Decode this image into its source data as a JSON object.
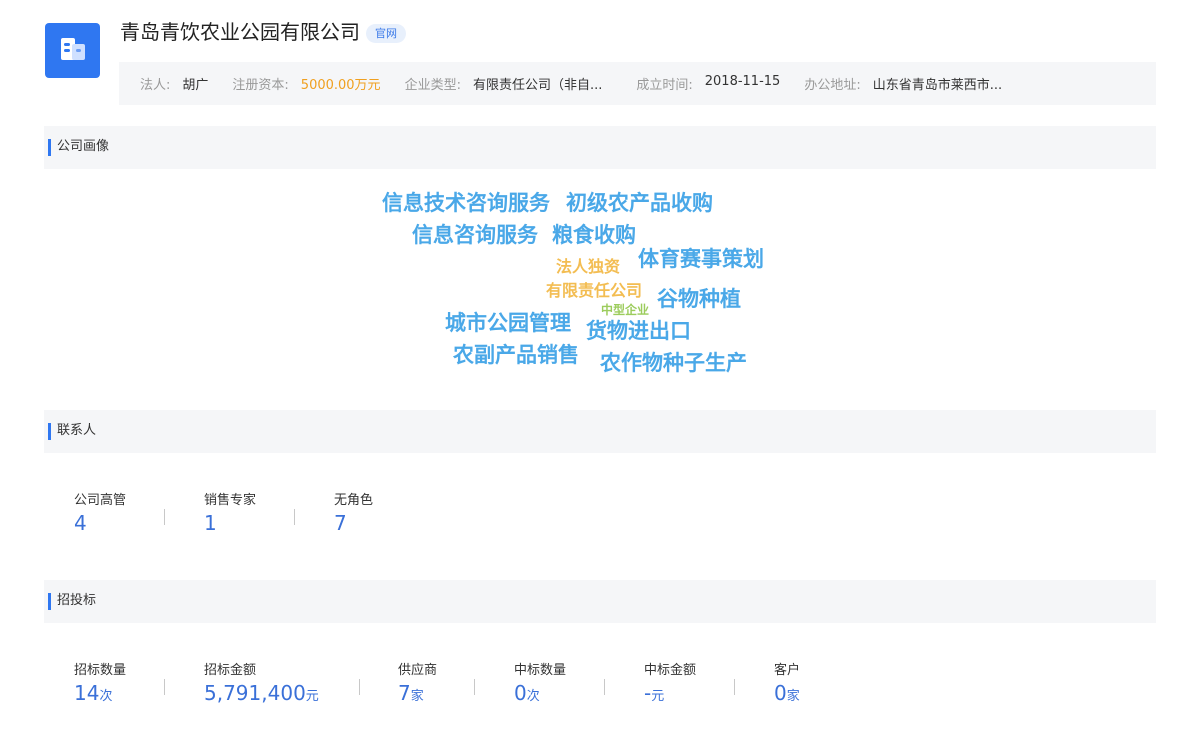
{
  "company": {
    "name": "青岛青饮农业公园有限公司",
    "badge": "官网",
    "logo_icon": "building-icon",
    "info": [
      {
        "label": "法人:",
        "value": "胡广"
      },
      {
        "label": "注册资本:",
        "value": "5000.00万元",
        "color": "#f0a020"
      },
      {
        "label": "企业类型:",
        "value": "有限责任公司（非自..."
      },
      {
        "label": "成立时间:",
        "value": "2018-11-15"
      },
      {
        "label": "办公地址:",
        "value": "山东省青岛市莱西市..."
      }
    ]
  },
  "profile": {
    "title": "公司画像",
    "words": [
      {
        "text": "信息技术咨询服务",
        "color": "#4aa8e8"
      },
      {
        "text": "初级农产品收购",
        "color": "#4aa8e8"
      },
      {
        "text": "信息咨询服务",
        "color": "#4aa8e8"
      },
      {
        "text": "粮食收购",
        "color": "#4aa8e8"
      },
      {
        "text": "法人独资",
        "color": "#f3bd52"
      },
      {
        "text": "体育赛事策划",
        "color": "#4aa8e8"
      },
      {
        "text": "有限责任公司",
        "color": "#f3bd52"
      },
      {
        "text": "中型企业",
        "color": "#9ccc5c"
      },
      {
        "text": "谷物种植",
        "color": "#4aa8e8"
      },
      {
        "text": "城市公园管理",
        "color": "#4aa8e8"
      },
      {
        "text": "货物进出口",
        "color": "#4aa8e8"
      },
      {
        "text": "农副产品销售",
        "color": "#4aa8e8"
      },
      {
        "text": "农作物种子生产",
        "color": "#4aa8e8"
      }
    ]
  },
  "contacts": {
    "title": "联系人",
    "stats": [
      {
        "label": "公司高管",
        "value": "4",
        "unit": ""
      },
      {
        "label": "销售专家",
        "value": "1",
        "unit": ""
      },
      {
        "label": "无角色",
        "value": "7",
        "unit": ""
      }
    ]
  },
  "bidding": {
    "title": "招投标",
    "stats": [
      {
        "label": "招标数量",
        "value": "14",
        "unit": "次"
      },
      {
        "label": "招标金额",
        "value": "5,791,400",
        "unit": "元"
      },
      {
        "label": "供应商",
        "value": "7",
        "unit": "家"
      },
      {
        "label": "中标数量",
        "value": "0",
        "unit": "次"
      },
      {
        "label": "中标金额",
        "value": "-",
        "unit": "元"
      },
      {
        "label": "客户",
        "value": "0",
        "unit": "家"
      }
    ]
  }
}
